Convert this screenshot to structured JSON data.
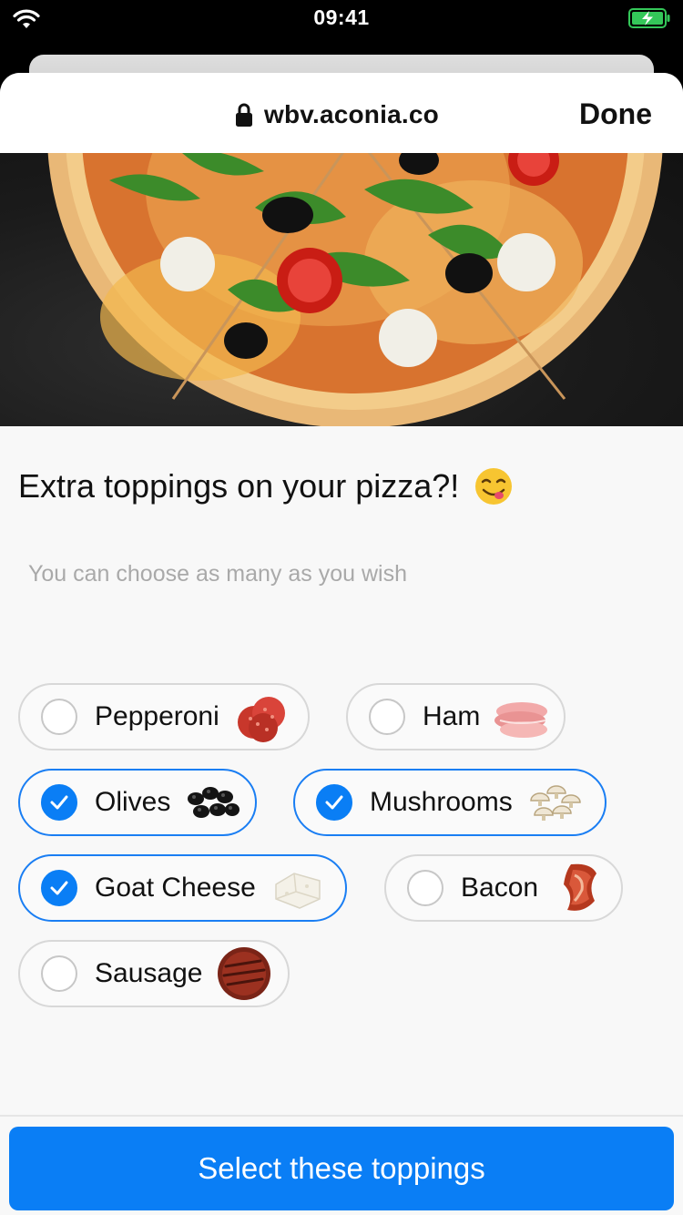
{
  "status_bar": {
    "time": "09:41"
  },
  "browser": {
    "url": "wbv.aconia.co",
    "done_label": "Done"
  },
  "page": {
    "question": "Extra toppings on your pizza?!",
    "hint": "You can choose as many as you wish",
    "submit_label": "Select these toppings"
  },
  "toppings": [
    {
      "label": "Pepperoni",
      "selected": false,
      "icon": "pepperoni-icon"
    },
    {
      "label": "Ham",
      "selected": false,
      "icon": "ham-icon"
    },
    {
      "label": "Olives",
      "selected": true,
      "icon": "olives-icon"
    },
    {
      "label": "Mushrooms",
      "selected": true,
      "icon": "mushrooms-icon"
    },
    {
      "label": "Goat Cheese",
      "selected": true,
      "icon": "goat-cheese-icon"
    },
    {
      "label": "Bacon",
      "selected": false,
      "icon": "bacon-icon"
    },
    {
      "label": "Sausage",
      "selected": false,
      "icon": "sausage-icon"
    }
  ],
  "colors": {
    "accent": "#0a7ef5",
    "selected_border": "#1a7ef3",
    "battery": "#34c759"
  }
}
